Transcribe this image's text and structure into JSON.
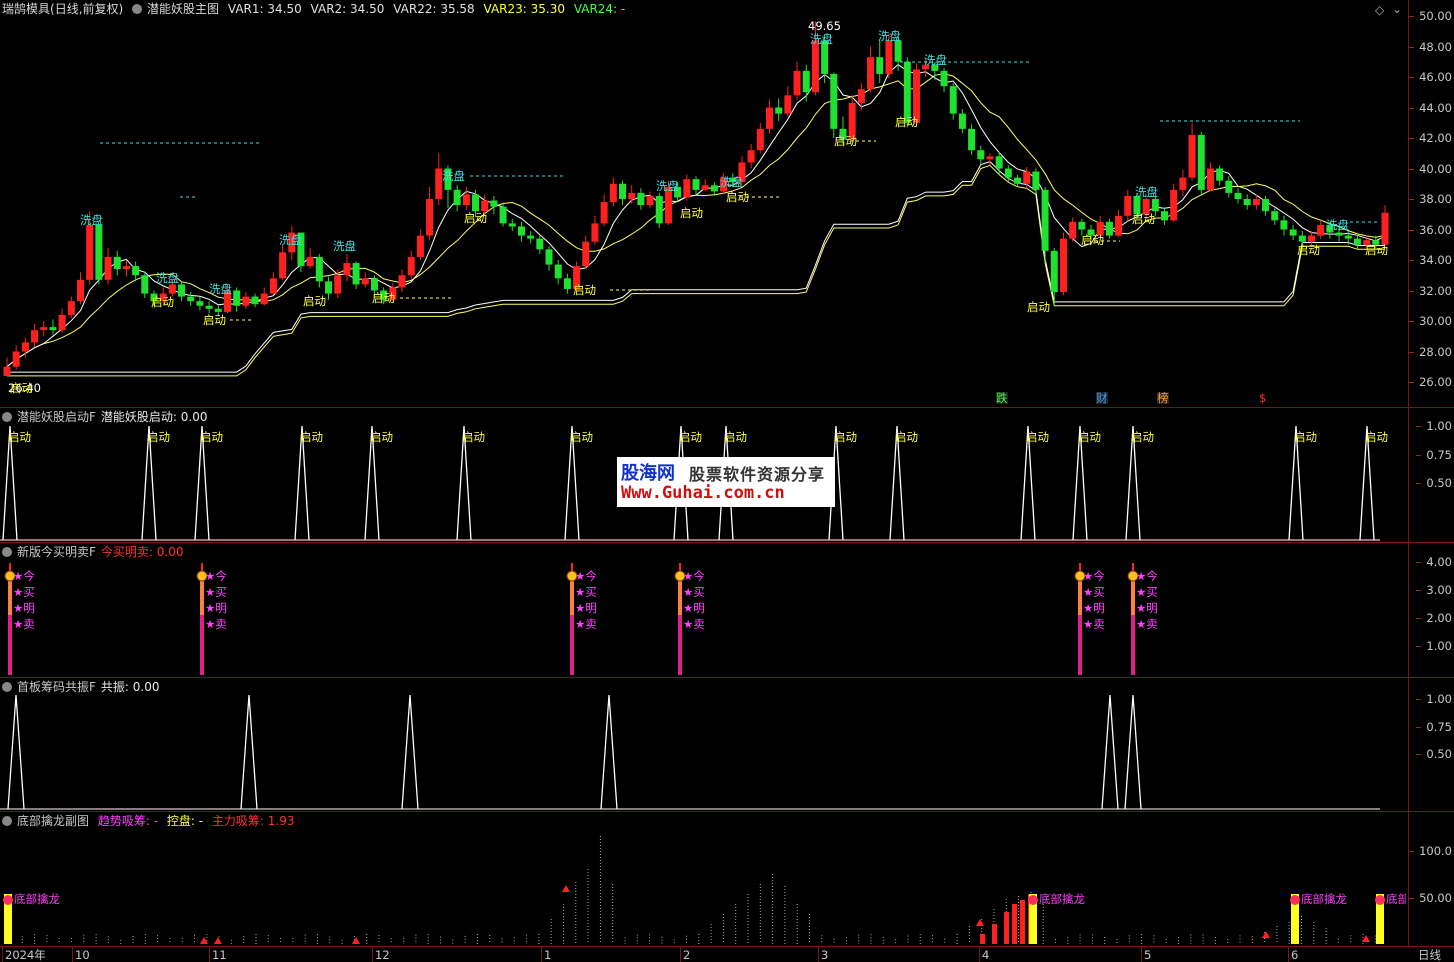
{
  "main": {
    "stock_name": "瑞鹄模具",
    "period": "(日线,前复权)",
    "indicator": "潜能妖股主图",
    "var1": "VAR1: 34.50",
    "var2": "VAR2: 34.50",
    "var22": "VAR22: 35.58",
    "var23": "VAR23: 35.30",
    "var24": "VAR24: -",
    "high_label": "49.65",
    "low_label": "26.40",
    "y_ticks": [
      "50.00",
      "48.00",
      "46.00",
      "44.00",
      "42.00",
      "40.00",
      "38.00",
      "36.00",
      "34.00",
      "32.00",
      "30.00",
      "28.00",
      "26.00"
    ],
    "wash_label": "洗盘",
    "start_label": "启动",
    "markers": [
      "跌",
      "财",
      "榜",
      "$"
    ]
  },
  "pane2": {
    "title": "潜能妖股启动F",
    "value": "潜能妖股启动: 0.00",
    "start_label": "启动",
    "y_ticks": [
      "1.00",
      "0.75",
      "0.50"
    ]
  },
  "pane3": {
    "title": "新版今买明卖F",
    "value": "今买明卖: 0.00",
    "chars": [
      "★今",
      "★买",
      "★明",
      "★卖"
    ],
    "y_ticks": [
      "4.00",
      "3.00",
      "2.00",
      "1.00"
    ]
  },
  "pane4": {
    "title": "首板筹码共振F",
    "value": "共振: 0.00",
    "y_ticks": [
      "1.00",
      "0.75",
      "0.50"
    ]
  },
  "pane5": {
    "title": "底部擒龙副图",
    "trend": "趋势吸筹: -",
    "control": "控盘: -",
    "main_force": "主力吸筹: 1.93",
    "label": "底部擒龙",
    "y_ticks": [
      "100.0",
      "50.00"
    ]
  },
  "xaxis": {
    "labels": [
      "2024年",
      "10",
      "11",
      "12",
      "1",
      "2",
      "3",
      "4",
      "5",
      "6"
    ],
    "period_label": "日线"
  },
  "watermark": {
    "brand": "股海网",
    "slogan": "股票软件资源分享",
    "url": "Www.Guhai.com.cn"
  },
  "colors": {
    "up": "#ff2020",
    "down": "#20e030",
    "wash": "#40e0e0",
    "start": "#ffff40",
    "magenta": "#ff40ff"
  },
  "chart_data": {
    "type": "candlestick",
    "ylim": [
      25.2,
      50.6
    ],
    "candles": [
      [
        26.4,
        27.0,
        27.6,
        26.4
      ],
      [
        27.0,
        28.0,
        28.4,
        26.8
      ],
      [
        28.0,
        28.6,
        28.9,
        27.6
      ],
      [
        28.6,
        29.4,
        29.8,
        28.3
      ],
      [
        29.4,
        29.6,
        30.0,
        29.0
      ],
      [
        29.6,
        29.4,
        30.1,
        29.1
      ],
      [
        29.4,
        30.4,
        30.8,
        29.2
      ],
      [
        30.4,
        31.3,
        31.6,
        30.2
      ],
      [
        31.3,
        32.7,
        33.2,
        31.1
      ],
      [
        32.7,
        36.3,
        37.2,
        32.4
      ],
      [
        36.3,
        32.7,
        36.0,
        32.4
      ],
      [
        32.7,
        34.2,
        34.8,
        32.4
      ],
      [
        34.2,
        33.4,
        34.6,
        33.0
      ],
      [
        33.4,
        33.6,
        34.0,
        32.9
      ],
      [
        33.6,
        33.0,
        33.9,
        32.6
      ],
      [
        33.0,
        31.8,
        33.2,
        31.5
      ],
      [
        31.8,
        31.3,
        32.0,
        31.0
      ],
      [
        31.3,
        31.8,
        32.2,
        31.1
      ],
      [
        31.8,
        32.4,
        32.7,
        31.6
      ],
      [
        32.4,
        31.6,
        32.6,
        31.3
      ],
      [
        31.6,
        31.3,
        31.9,
        31.0
      ],
      [
        31.3,
        31.0,
        31.6,
        30.7
      ],
      [
        31.0,
        30.8,
        31.3,
        30.5
      ],
      [
        30.8,
        30.6,
        31.0,
        30.3
      ],
      [
        30.6,
        32.0,
        32.4,
        30.5
      ],
      [
        32.0,
        31.0,
        32.2,
        30.6
      ],
      [
        31.0,
        31.6,
        31.9,
        30.8
      ],
      [
        31.6,
        31.1,
        31.8,
        30.9
      ],
      [
        31.1,
        31.8,
        32.2,
        31.0
      ],
      [
        31.8,
        32.8,
        33.2,
        31.7
      ],
      [
        32.8,
        34.5,
        35.0,
        32.7
      ],
      [
        34.5,
        35.8,
        36.2,
        34.0
      ],
      [
        35.8,
        33.6,
        35.6,
        33.2
      ],
      [
        33.6,
        34.2,
        34.8,
        33.4
      ],
      [
        34.2,
        32.6,
        34.4,
        32.2
      ],
      [
        32.6,
        31.8,
        32.9,
        31.4
      ],
      [
        31.8,
        33.0,
        33.4,
        31.5
      ],
      [
        33.0,
        33.8,
        34.4,
        32.6
      ],
      [
        33.8,
        32.4,
        33.9,
        32.1
      ],
      [
        32.4,
        32.8,
        33.2,
        32.2
      ],
      [
        32.8,
        32.0,
        33.0,
        31.6
      ],
      [
        32.0,
        31.4,
        32.2,
        31.1
      ],
      [
        31.4,
        32.2,
        32.5,
        31.3
      ],
      [
        32.2,
        33.0,
        33.4,
        31.9
      ],
      [
        33.0,
        34.2,
        34.6,
        32.7
      ],
      [
        34.2,
        35.6,
        36.0,
        34.0
      ],
      [
        35.6,
        38.0,
        38.8,
        35.3
      ],
      [
        38.0,
        40.0,
        41.0,
        37.6
      ],
      [
        40.0,
        38.6,
        40.2,
        37.4
      ],
      [
        38.6,
        37.6,
        38.9,
        37.2
      ],
      [
        37.6,
        38.3,
        38.8,
        37.3
      ],
      [
        38.3,
        37.2,
        38.6,
        36.8
      ],
      [
        37.2,
        37.9,
        38.3,
        37.0
      ],
      [
        37.9,
        37.5,
        38.2,
        37.0
      ],
      [
        37.5,
        36.4,
        37.7,
        36.2
      ],
      [
        36.4,
        36.2,
        36.7,
        35.9
      ],
      [
        36.2,
        35.6,
        36.5,
        35.2
      ],
      [
        35.6,
        35.4,
        35.9,
        35.1
      ],
      [
        35.4,
        34.7,
        35.6,
        34.4
      ],
      [
        34.7,
        33.7,
        34.9,
        33.3
      ],
      [
        33.7,
        32.8,
        34.0,
        32.4
      ],
      [
        32.8,
        32.1,
        33.1,
        31.8
      ],
      [
        32.1,
        33.6,
        33.9,
        31.9
      ],
      [
        33.6,
        35.2,
        35.6,
        33.4
      ],
      [
        35.2,
        36.4,
        36.9,
        35.0
      ],
      [
        36.4,
        37.8,
        38.3,
        36.2
      ],
      [
        37.8,
        39.0,
        39.4,
        37.5
      ],
      [
        39.0,
        38.0,
        39.2,
        37.6
      ],
      [
        38.0,
        38.4,
        38.9,
        37.7
      ],
      [
        38.4,
        37.6,
        38.7,
        37.3
      ],
      [
        37.6,
        38.2,
        38.5,
        37.4
      ],
      [
        38.2,
        36.4,
        38.4,
        36.1
      ],
      [
        36.4,
        38.8,
        39.2,
        36.3
      ],
      [
        38.8,
        38.1,
        39.1,
        37.8
      ],
      [
        38.1,
        39.3,
        39.6,
        37.9
      ],
      [
        39.3,
        38.6,
        39.5,
        38.2
      ],
      [
        38.6,
        38.9,
        39.3,
        38.5
      ],
      [
        38.9,
        38.5,
        39.1,
        38.2
      ],
      [
        38.5,
        39.4,
        39.7,
        38.3
      ],
      [
        39.4,
        39.1,
        39.7,
        38.9
      ],
      [
        39.1,
        40.4,
        40.8,
        38.9
      ],
      [
        40.4,
        41.2,
        41.6,
        40.0
      ],
      [
        41.2,
        42.6,
        43.0,
        41.0
      ],
      [
        42.6,
        44.0,
        44.5,
        42.3
      ],
      [
        44.0,
        43.6,
        44.6,
        43.1
      ],
      [
        43.6,
        44.8,
        45.4,
        43.4
      ],
      [
        44.8,
        46.4,
        47.0,
        44.5
      ],
      [
        46.4,
        45.0,
        46.8,
        44.4
      ],
      [
        45.0,
        48.4,
        49.65,
        44.8
      ],
      [
        48.4,
        46.2,
        48.6,
        45.6
      ],
      [
        46.2,
        42.6,
        46.3,
        42.0
      ],
      [
        42.6,
        41.9,
        43.4,
        41.6
      ],
      [
        41.9,
        44.3,
        44.8,
        41.7
      ],
      [
        44.3,
        45.2,
        45.6,
        43.8
      ],
      [
        45.2,
        47.3,
        48.0,
        45.0
      ],
      [
        47.3,
        46.2,
        48.4,
        45.6
      ],
      [
        46.2,
        48.4,
        48.9,
        45.9
      ],
      [
        48.4,
        47.0,
        48.6,
        46.4
      ],
      [
        47.0,
        43.0,
        47.3,
        42.7
      ],
      [
        43.0,
        46.5,
        46.9,
        42.8
      ],
      [
        46.5,
        46.8,
        47.2,
        46.0
      ],
      [
        46.8,
        46.4,
        47.0,
        45.8
      ],
      [
        46.4,
        45.4,
        46.6,
        45.0
      ],
      [
        45.4,
        43.6,
        45.6,
        43.2
      ],
      [
        43.6,
        42.6,
        43.9,
        42.3
      ],
      [
        42.6,
        41.2,
        42.9,
        40.9
      ],
      [
        41.2,
        40.6,
        41.5,
        40.2
      ],
      [
        40.6,
        40.8,
        41.0,
        40.2
      ],
      [
        40.8,
        40.0,
        41.1,
        39.6
      ],
      [
        40.0,
        39.4,
        40.2,
        39.1
      ],
      [
        39.4,
        39.0,
        39.6,
        38.8
      ],
      [
        39.0,
        39.8,
        40.1,
        38.7
      ],
      [
        39.8,
        38.6,
        40.0,
        38.3
      ],
      [
        38.6,
        34.6,
        38.8,
        33.8
      ],
      [
        34.6,
        31.9,
        34.8,
        31.0
      ],
      [
        31.9,
        35.4,
        35.8,
        31.7
      ],
      [
        35.4,
        36.5,
        36.8,
        35.2
      ],
      [
        36.5,
        36.0,
        36.7,
        35.6
      ],
      [
        36.0,
        35.6,
        36.3,
        35.3
      ],
      [
        35.6,
        36.5,
        36.9,
        35.5
      ],
      [
        36.5,
        35.6,
        36.7,
        35.4
      ],
      [
        35.6,
        36.9,
        37.3,
        35.5
      ],
      [
        36.9,
        38.2,
        38.6,
        36.6
      ],
      [
        38.2,
        37.0,
        38.4,
        36.7
      ],
      [
        37.0,
        38.0,
        38.3,
        36.8
      ],
      [
        38.0,
        37.2,
        38.2,
        36.9
      ],
      [
        37.2,
        36.6,
        37.4,
        36.3
      ],
      [
        36.6,
        38.6,
        39.0,
        36.5
      ],
      [
        38.6,
        39.4,
        39.9,
        38.2
      ],
      [
        39.4,
        42.2,
        43.0,
        39.2
      ],
      [
        42.2,
        38.6,
        42.4,
        38.3
      ],
      [
        38.6,
        40.0,
        40.4,
        38.5
      ],
      [
        40.0,
        39.2,
        40.2,
        38.9
      ],
      [
        39.2,
        38.4,
        39.5,
        38.1
      ],
      [
        38.4,
        38.0,
        38.7,
        37.7
      ],
      [
        38.0,
        37.6,
        38.3,
        37.3
      ],
      [
        37.6,
        38.0,
        38.3,
        37.3
      ],
      [
        38.0,
        37.2,
        38.2,
        36.9
      ],
      [
        37.2,
        36.6,
        37.4,
        36.3
      ],
      [
        36.6,
        36.0,
        36.9,
        35.6
      ],
      [
        36.0,
        35.6,
        36.3,
        35.3
      ],
      [
        35.6,
        35.2,
        35.9,
        34.9
      ],
      [
        35.2,
        35.6,
        35.9,
        35.0
      ],
      [
        35.6,
        36.3,
        36.6,
        35.4
      ],
      [
        36.3,
        35.8,
        36.5,
        35.4
      ],
      [
        35.8,
        35.6,
        36.2,
        35.2
      ],
      [
        35.6,
        35.4,
        35.9,
        35.0
      ],
      [
        35.4,
        35.0,
        35.7,
        34.7
      ],
      [
        35.0,
        35.3,
        35.6,
        34.8
      ],
      [
        35.3,
        35.0,
        35.6,
        34.7
      ],
      [
        35.0,
        37.1,
        37.6,
        34.9
      ]
    ]
  }
}
